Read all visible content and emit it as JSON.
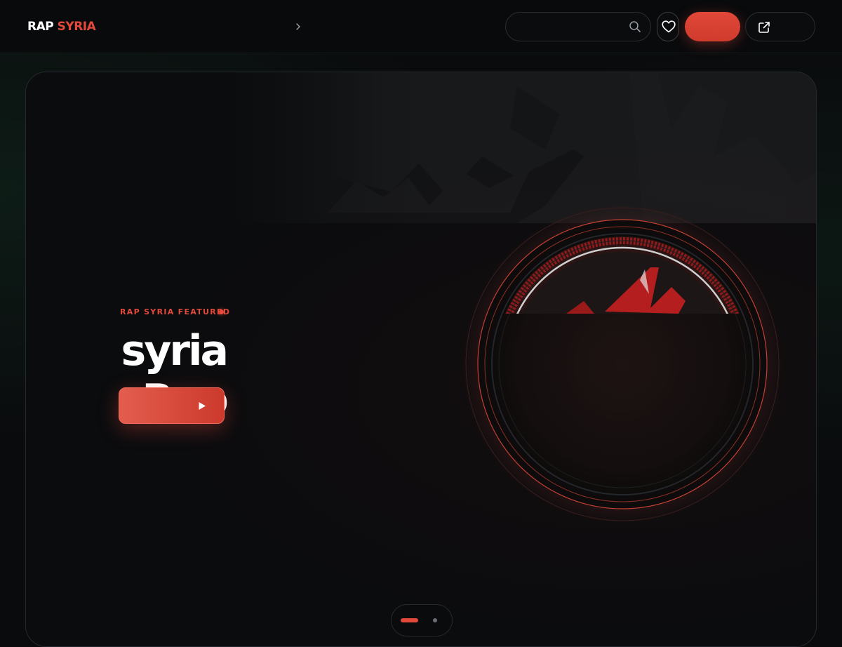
{
  "header": {
    "logo_word": "RAP",
    "logo_accent": "SYRIA"
  },
  "hero": {
    "eyebrow": "RAP SYRIA FEATURED",
    "title": "syria Rap"
  },
  "pagination": {
    "total": 2,
    "active_index": 1
  },
  "colors": {
    "accent": "#e2493b",
    "background": "#0a0b0d"
  },
  "icons": [
    "chevron-right-icon",
    "search-icon",
    "heart-icon",
    "external-link-icon",
    "play-icon"
  ]
}
